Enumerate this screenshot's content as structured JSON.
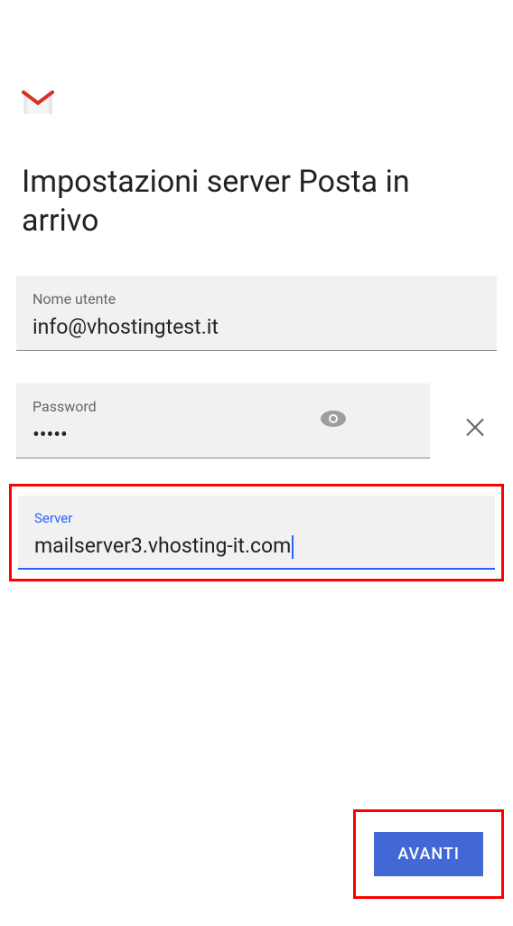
{
  "title": "Impostazioni server Posta in arrivo",
  "fields": {
    "username": {
      "label": "Nome utente",
      "value": "info@vhostingtest.it"
    },
    "password": {
      "label": "Password",
      "value": "•••••"
    },
    "server": {
      "label": "Server",
      "value": "mailserver3.vhosting-it.com"
    }
  },
  "buttons": {
    "next": "AVANTI"
  }
}
